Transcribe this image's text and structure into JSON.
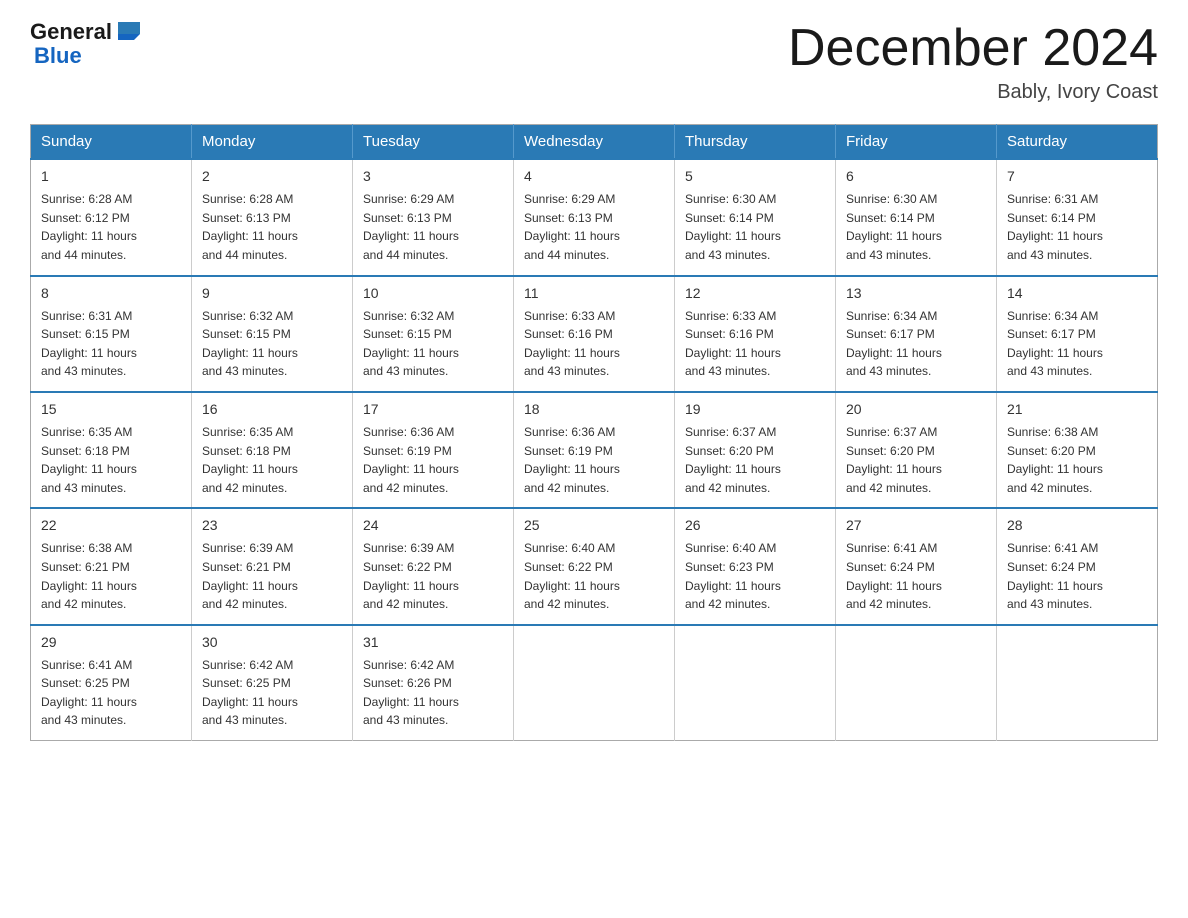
{
  "header": {
    "logo_general": "General",
    "logo_blue": "Blue",
    "month_title": "December 2024",
    "location": "Bably, Ivory Coast"
  },
  "days_of_week": [
    "Sunday",
    "Monday",
    "Tuesday",
    "Wednesday",
    "Thursday",
    "Friday",
    "Saturday"
  ],
  "weeks": [
    [
      {
        "day": "1",
        "sunrise": "6:28 AM",
        "sunset": "6:12 PM",
        "daylight": "11 hours and 44 minutes."
      },
      {
        "day": "2",
        "sunrise": "6:28 AM",
        "sunset": "6:13 PM",
        "daylight": "11 hours and 44 minutes."
      },
      {
        "day": "3",
        "sunrise": "6:29 AM",
        "sunset": "6:13 PM",
        "daylight": "11 hours and 44 minutes."
      },
      {
        "day": "4",
        "sunrise": "6:29 AM",
        "sunset": "6:13 PM",
        "daylight": "11 hours and 44 minutes."
      },
      {
        "day": "5",
        "sunrise": "6:30 AM",
        "sunset": "6:14 PM",
        "daylight": "11 hours and 43 minutes."
      },
      {
        "day": "6",
        "sunrise": "6:30 AM",
        "sunset": "6:14 PM",
        "daylight": "11 hours and 43 minutes."
      },
      {
        "day": "7",
        "sunrise": "6:31 AM",
        "sunset": "6:14 PM",
        "daylight": "11 hours and 43 minutes."
      }
    ],
    [
      {
        "day": "8",
        "sunrise": "6:31 AM",
        "sunset": "6:15 PM",
        "daylight": "11 hours and 43 minutes."
      },
      {
        "day": "9",
        "sunrise": "6:32 AM",
        "sunset": "6:15 PM",
        "daylight": "11 hours and 43 minutes."
      },
      {
        "day": "10",
        "sunrise": "6:32 AM",
        "sunset": "6:15 PM",
        "daylight": "11 hours and 43 minutes."
      },
      {
        "day": "11",
        "sunrise": "6:33 AM",
        "sunset": "6:16 PM",
        "daylight": "11 hours and 43 minutes."
      },
      {
        "day": "12",
        "sunrise": "6:33 AM",
        "sunset": "6:16 PM",
        "daylight": "11 hours and 43 minutes."
      },
      {
        "day": "13",
        "sunrise": "6:34 AM",
        "sunset": "6:17 PM",
        "daylight": "11 hours and 43 minutes."
      },
      {
        "day": "14",
        "sunrise": "6:34 AM",
        "sunset": "6:17 PM",
        "daylight": "11 hours and 43 minutes."
      }
    ],
    [
      {
        "day": "15",
        "sunrise": "6:35 AM",
        "sunset": "6:18 PM",
        "daylight": "11 hours and 43 minutes."
      },
      {
        "day": "16",
        "sunrise": "6:35 AM",
        "sunset": "6:18 PM",
        "daylight": "11 hours and 42 minutes."
      },
      {
        "day": "17",
        "sunrise": "6:36 AM",
        "sunset": "6:19 PM",
        "daylight": "11 hours and 42 minutes."
      },
      {
        "day": "18",
        "sunrise": "6:36 AM",
        "sunset": "6:19 PM",
        "daylight": "11 hours and 42 minutes."
      },
      {
        "day": "19",
        "sunrise": "6:37 AM",
        "sunset": "6:20 PM",
        "daylight": "11 hours and 42 minutes."
      },
      {
        "day": "20",
        "sunrise": "6:37 AM",
        "sunset": "6:20 PM",
        "daylight": "11 hours and 42 minutes."
      },
      {
        "day": "21",
        "sunrise": "6:38 AM",
        "sunset": "6:20 PM",
        "daylight": "11 hours and 42 minutes."
      }
    ],
    [
      {
        "day": "22",
        "sunrise": "6:38 AM",
        "sunset": "6:21 PM",
        "daylight": "11 hours and 42 minutes."
      },
      {
        "day": "23",
        "sunrise": "6:39 AM",
        "sunset": "6:21 PM",
        "daylight": "11 hours and 42 minutes."
      },
      {
        "day": "24",
        "sunrise": "6:39 AM",
        "sunset": "6:22 PM",
        "daylight": "11 hours and 42 minutes."
      },
      {
        "day": "25",
        "sunrise": "6:40 AM",
        "sunset": "6:22 PM",
        "daylight": "11 hours and 42 minutes."
      },
      {
        "day": "26",
        "sunrise": "6:40 AM",
        "sunset": "6:23 PM",
        "daylight": "11 hours and 42 minutes."
      },
      {
        "day": "27",
        "sunrise": "6:41 AM",
        "sunset": "6:24 PM",
        "daylight": "11 hours and 42 minutes."
      },
      {
        "day": "28",
        "sunrise": "6:41 AM",
        "sunset": "6:24 PM",
        "daylight": "11 hours and 43 minutes."
      }
    ],
    [
      {
        "day": "29",
        "sunrise": "6:41 AM",
        "sunset": "6:25 PM",
        "daylight": "11 hours and 43 minutes."
      },
      {
        "day": "30",
        "sunrise": "6:42 AM",
        "sunset": "6:25 PM",
        "daylight": "11 hours and 43 minutes."
      },
      {
        "day": "31",
        "sunrise": "6:42 AM",
        "sunset": "6:26 PM",
        "daylight": "11 hours and 43 minutes."
      },
      null,
      null,
      null,
      null
    ]
  ],
  "labels": {
    "sunrise": "Sunrise:",
    "sunset": "Sunset:",
    "daylight": "Daylight:"
  }
}
